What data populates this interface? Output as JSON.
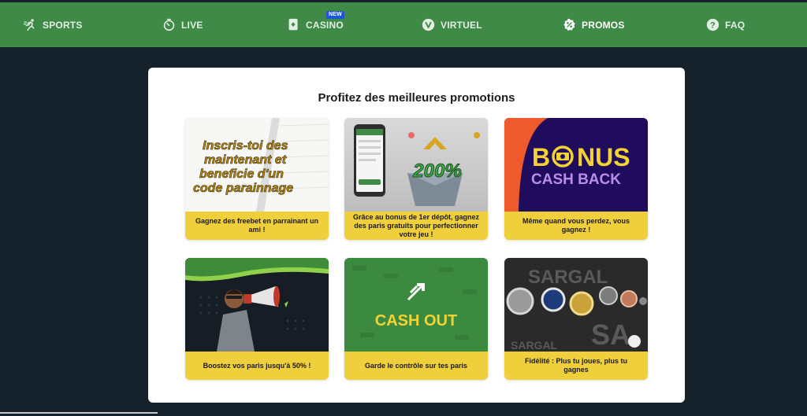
{
  "nav": {
    "items": [
      {
        "label": "SPORTS",
        "icon": "running-icon"
      },
      {
        "label": "LIVE",
        "icon": "stopwatch-icon"
      },
      {
        "label": "CASINO",
        "icon": "card-icon",
        "badge": "NEW"
      },
      {
        "label": "VIRTUEL",
        "icon": "v-circle-icon"
      },
      {
        "label": "PROMOS",
        "icon": "percent-icon",
        "active": true
      },
      {
        "label": "FAQ",
        "icon": "question-icon"
      }
    ]
  },
  "page": {
    "title": "Profitez des meilleures promotions"
  },
  "promos": [
    {
      "image_text": [
        "Inscris-toi des",
        "maintenant et",
        "beneficie d'un",
        "code parainnage"
      ],
      "caption": "Gagnez des freebet en parrainant un ami !"
    },
    {
      "image_text": [
        "200%"
      ],
      "caption": "Grâce au bonus de 1er dépôt, gagnez des paris gratuits pour perfectionner votre jeu !"
    },
    {
      "image_text": [
        "B",
        "NUS",
        "CASH BACK"
      ],
      "caption": "Même quand vous perdez, vous gagnez !"
    },
    {
      "image_text": [],
      "caption": "Boostez vos paris jusqu'à 50% !"
    },
    {
      "image_text": [
        "CASH OUT"
      ],
      "caption": "Garde le contrôle sur tes paris"
    },
    {
      "image_text": [
        "SARGAL",
        "SARGAL",
        "SA"
      ],
      "caption": "Fidélité : Plus tu joues, plus tu gagnes"
    }
  ],
  "colors": {
    "nav_bg": "#3f8a46",
    "page_bg": "#16222b",
    "caption_bg": "#f0cf3c",
    "badge_bg": "#1e57d6"
  }
}
